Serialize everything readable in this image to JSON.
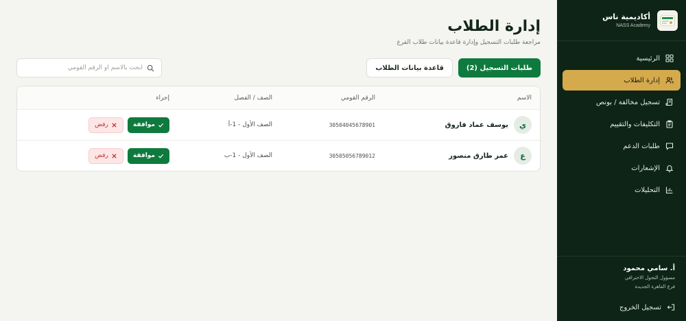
{
  "brand": {
    "name": "أكاديمية ناس",
    "sub": "NASS Academy"
  },
  "nav": [
    {
      "label": "الرئيسية",
      "icon": "grid-icon"
    },
    {
      "label": "إدارة الطلاب",
      "icon": "users-icon",
      "active": true
    },
    {
      "label": "تسجيل مخالفة / بونص",
      "icon": "scroll-icon"
    },
    {
      "label": "التكليفات والتقييم",
      "icon": "clipboard-icon"
    },
    {
      "label": "طلبات الدعم",
      "icon": "message-icon"
    },
    {
      "label": "الإشعارات",
      "icon": "bell-icon"
    },
    {
      "label": "التحليلات",
      "icon": "chart-icon"
    }
  ],
  "user": {
    "name": "أ. سامي محمود",
    "role": "مسؤول التحول الاحترافي",
    "branch": "فرع القاهرة الجديدة"
  },
  "logout_label": "تسجيل الخروج",
  "page": {
    "title": "إدارة الطلاب",
    "subtitle": "مراجعة طلبات التسجيل وإدارة قاعدة بيانات طلاب الفرع"
  },
  "tabs": {
    "requests": "طلبات التسجيل (2)",
    "database": "قاعدة بيانات الطلاب"
  },
  "search": {
    "placeholder": "ابحث بالاسم أو الرقم القومي",
    "value": ""
  },
  "table": {
    "headers": {
      "name": "الاسم",
      "nid": "الرقم القومي",
      "class": "الصف / الفصل",
      "action": "إجراء"
    },
    "rows": [
      {
        "initial": "ي",
        "name": "يوسف عماد فاروق",
        "nid": "30504045678901",
        "class": "الصف الأول - 1-أ"
      },
      {
        "initial": "ع",
        "name": "عمر طارق منصور",
        "nid": "30505056789012",
        "class": "الصف الأول - 1-ب"
      }
    ],
    "approve_label": "موافقة",
    "reject_label": "رفض"
  },
  "colors": {
    "sidebar": "#0d2416",
    "accent": "#d4aa4d",
    "primary": "#0f7a3e",
    "danger": "#c03030"
  }
}
